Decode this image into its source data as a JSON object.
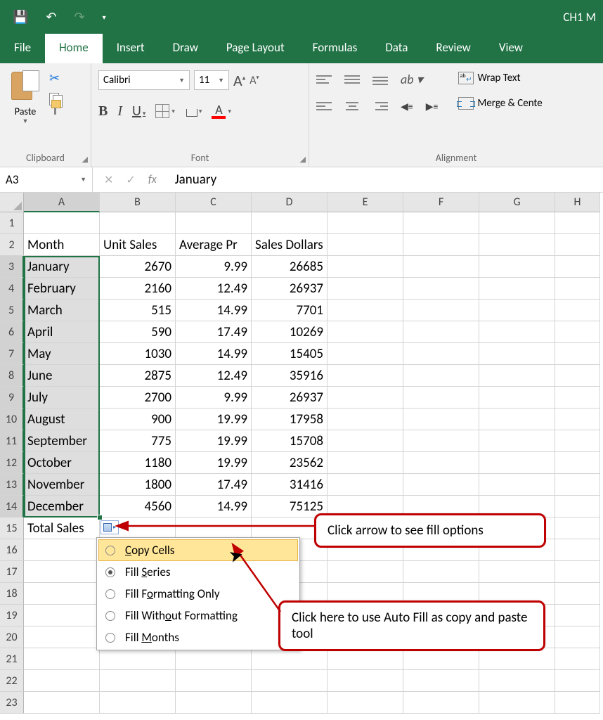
{
  "title_fragment": "CH1 M",
  "tabs": [
    "File",
    "Home",
    "Insert",
    "Draw",
    "Page Layout",
    "Formulas",
    "Data",
    "Review",
    "View"
  ],
  "active_tab": "Home",
  "paste_label": "Paste",
  "group_labels": {
    "clipboard": "Clipboard",
    "font": "Font",
    "alignment": "Alignment"
  },
  "font": {
    "name": "Calibri",
    "size": "11"
  },
  "wrap_text": "Wrap Text",
  "merge_center": "Merge & Cente",
  "namebox": "A3",
  "formula_value": "January",
  "col_headers": [
    "A",
    "B",
    "C",
    "D",
    "E",
    "F",
    "G",
    "H"
  ],
  "row_headers": [
    "1",
    "2",
    "3",
    "4",
    "5",
    "6",
    "7",
    "8",
    "9",
    "10",
    "11",
    "12",
    "13",
    "14",
    "15",
    "16",
    "17",
    "18",
    "19",
    "20",
    "21",
    "22",
    "23"
  ],
  "data": {
    "2": {
      "A": "Month",
      "B": "Unit Sales",
      "C": "Average Pr",
      "D": "Sales Dollars"
    },
    "3": {
      "A": "January",
      "B": "2670",
      "C": "9.99",
      "D": "26685"
    },
    "4": {
      "A": "February",
      "B": "2160",
      "C": "12.49",
      "D": "26937"
    },
    "5": {
      "A": "March",
      "B": "515",
      "C": "14.99",
      "D": "7701"
    },
    "6": {
      "A": "April",
      "B": "590",
      "C": "17.49",
      "D": "10269"
    },
    "7": {
      "A": "May",
      "B": "1030",
      "C": "14.99",
      "D": "15405"
    },
    "8": {
      "A": "June",
      "B": "2875",
      "C": "12.49",
      "D": "35916"
    },
    "9": {
      "A": "July",
      "B": "2700",
      "C": "9.99",
      "D": "26937"
    },
    "10": {
      "A": "August",
      "B": "900",
      "C": "19.99",
      "D": "17958"
    },
    "11": {
      "A": "September",
      "B": "775",
      "C": "19.99",
      "D": "15708"
    },
    "12": {
      "A": "October",
      "B": "1180",
      "C": "19.99",
      "D": "23562"
    },
    "13": {
      "A": "November",
      "B": "1800",
      "C": "17.49",
      "D": "31416"
    },
    "14": {
      "A": "December",
      "B": "4560",
      "C": "14.99",
      "D": "75125"
    },
    "15": {
      "A": "Total Sales"
    }
  },
  "autofill_menu": [
    {
      "label_pre": "",
      "ul": "C",
      "label_post": "opy Cells",
      "selected": false,
      "hover": true
    },
    {
      "label_pre": "Fill ",
      "ul": "S",
      "label_post": "eries",
      "selected": true,
      "hover": false
    },
    {
      "label_pre": "Fill F",
      "ul": "o",
      "label_post": "rmatting Only",
      "selected": false,
      "hover": false
    },
    {
      "label_pre": "Fill With",
      "ul": "o",
      "label_post": "ut Formatting",
      "selected": false,
      "hover": false
    },
    {
      "label_pre": "Fill ",
      "ul": "M",
      "label_post": "onths",
      "selected": false,
      "hover": false
    }
  ],
  "callout1": "Click arrow to see fill options",
  "callout2": "Click here to use Auto Fill as copy and paste tool"
}
